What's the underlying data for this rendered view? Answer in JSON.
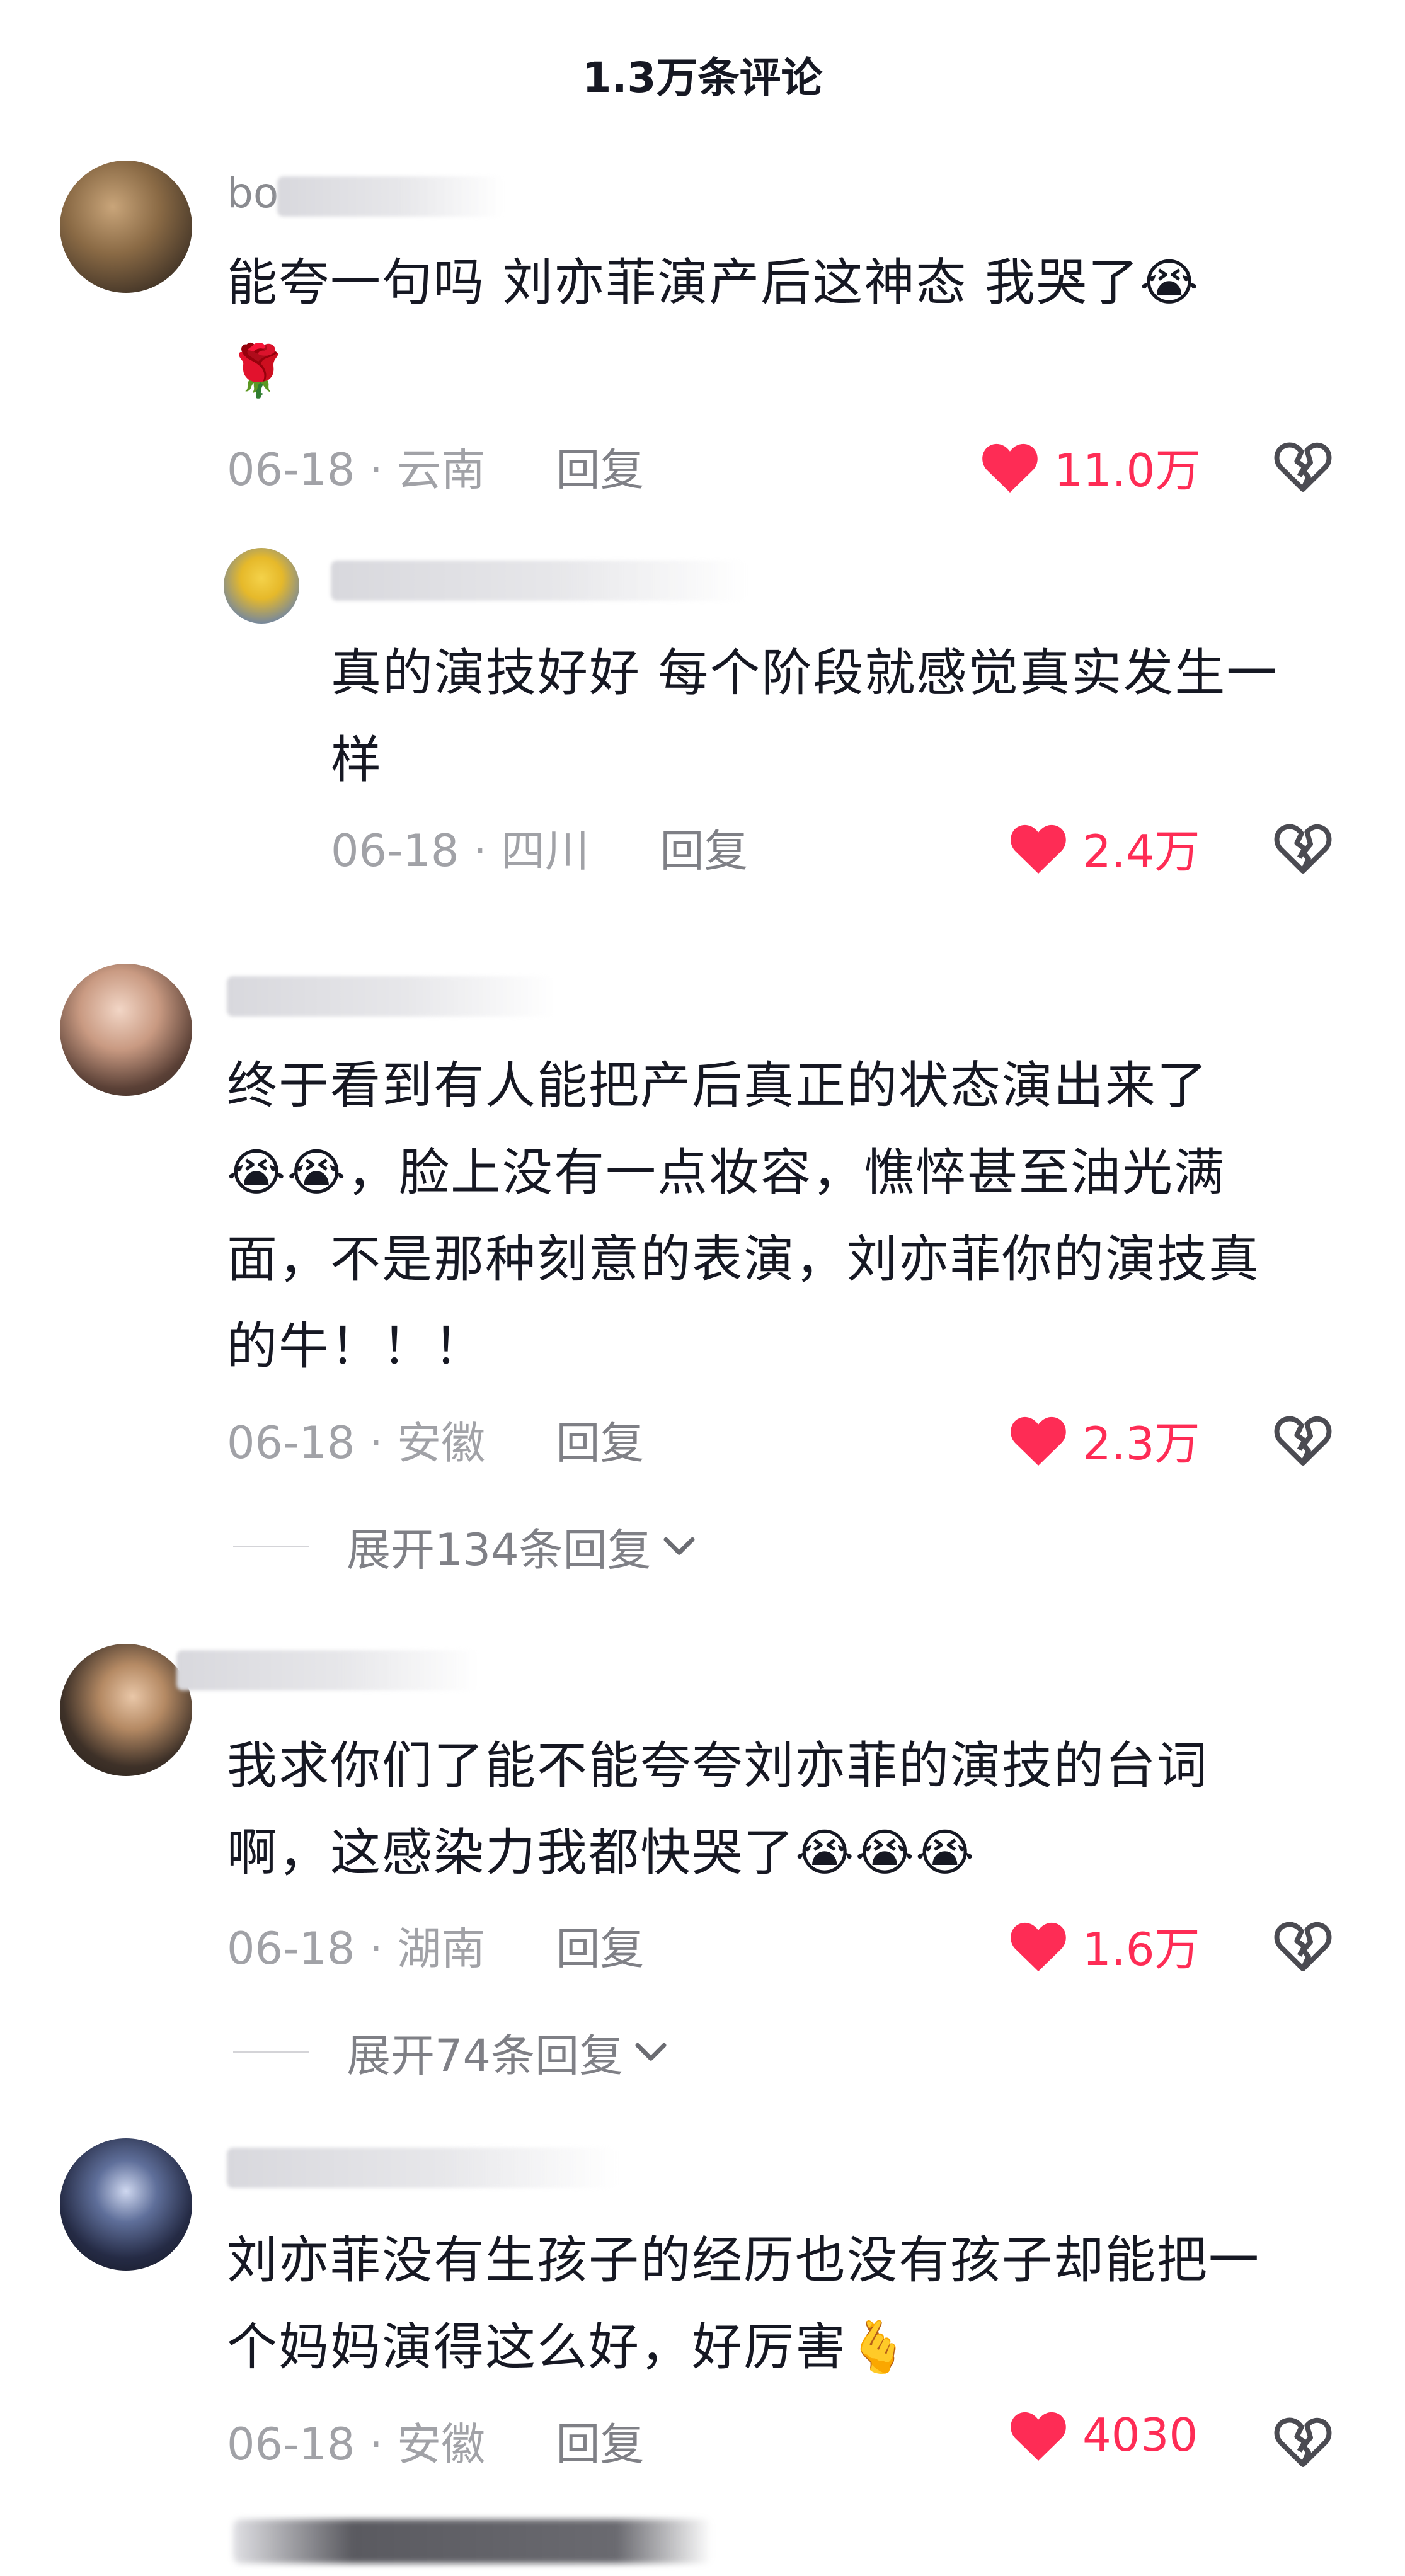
{
  "header": {
    "title": "1.3万条评论"
  },
  "colors": {
    "like": "#fe2c55",
    "muted": "#a1a2a7",
    "text": "#161823"
  },
  "comments": [
    {
      "username": "bo",
      "lines": [
        "能夸一句吗 刘亦菲演产后这神态 我哭了😭",
        "🌹"
      ],
      "date": "06-18",
      "location": "云南",
      "reply_label": "回复",
      "likes": "11.0万",
      "reply": {
        "lines": [
          "真的演技好好 每个阶段就感觉真实发生一",
          "样"
        ],
        "date": "06-18",
        "location": "四川",
        "reply_label": "回复",
        "likes": "2.4万"
      }
    },
    {
      "lines": [
        "终于看到有人能把产后真正的状态演出来了",
        "😭😭，脸上没有一点妆容，憔悴甚至油光满",
        "面，不是那种刻意的表演，刘亦菲你的演技真",
        "的牛！！！"
      ],
      "date": "06-18",
      "location": "安徽",
      "reply_label": "回复",
      "likes": "2.3万",
      "expand": "展开134条回复"
    },
    {
      "lines": [
        "我求你们了能不能夸夸刘亦菲的演技的台词",
        "啊，这感染力我都快哭了😭😭😭"
      ],
      "date": "06-18",
      "location": "湖南",
      "reply_label": "回复",
      "likes": "1.6万",
      "expand": "展开74条回复"
    },
    {
      "lines": [
        "刘亦菲没有生孩子的经历也没有孩子却能把一",
        "个妈妈演得这么好，好厉害🫰"
      ],
      "date": "06-18",
      "location": "安徽",
      "reply_label": "回复",
      "likes": "4030"
    }
  ],
  "icons": {
    "like": "heart-icon",
    "dislike": "broken-heart-icon",
    "expand": "chevron-down-icon"
  }
}
